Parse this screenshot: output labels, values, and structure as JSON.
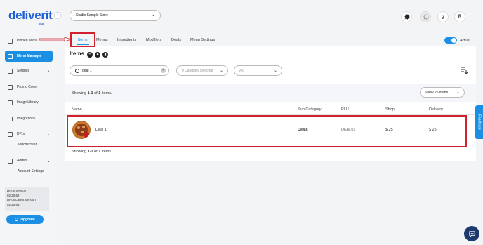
{
  "brand": {
    "name": "deliverit",
    "sub": "blue"
  },
  "sidebar": {
    "items": [
      {
        "label": "Pinned Menu",
        "icon": "pin-icon"
      },
      {
        "label": "Menu Manager",
        "icon": "menu-manager-icon"
      },
      {
        "label": "Settings",
        "icon": "settings-icon"
      },
      {
        "label": "Promo Code",
        "icon": "promo-icon"
      },
      {
        "label": "Image Library",
        "icon": "image-icon"
      },
      {
        "label": "Integrations",
        "icon": "integrations-icon"
      },
      {
        "label": "DPos",
        "icon": "dpos-icon"
      },
      {
        "label": "Admin",
        "icon": "admin-icon"
      }
    ],
    "sub_items": {
      "dpos": "Touchscreen",
      "admin": "Account Settings"
    },
    "version": {
      "dpos_label": "DPos Version",
      "dpos_value": "02.20.62",
      "latest_label": "DPos Latest Version",
      "latest_value": "02.20.63"
    },
    "upgrade_label": "Upgrade"
  },
  "header": {
    "store_select": "Studio Sample Store",
    "profile_initial": "R",
    "help": "?"
  },
  "tabs": [
    "Items",
    "Menus",
    "Ingredients",
    "Modifiers",
    "Deals",
    "Menu Settings"
  ],
  "active_label": "Active",
  "items_section": {
    "title": "Items",
    "search_value": "deal 1",
    "category_placeholder": "0 Category selected",
    "filter_value": "All",
    "showing_top": {
      "prefix": "Showing ",
      "range": "1-1",
      "mid": " of ",
      "count": "1",
      "suffix": " items."
    },
    "showing_bottom": {
      "prefix": "Showing ",
      "range": "1-1",
      "mid": " of ",
      "count": "1",
      "suffix": " items."
    },
    "per_page": "Show 25 Items",
    "columns": [
      "Name",
      "Sub Category",
      "PLU",
      "Shop",
      "Delivery"
    ],
    "rows": [
      {
        "name": "Deal 1",
        "sub_category": "Deals",
        "plu": "DEAL01",
        "shop": "$ 25",
        "delivery": "$ 25"
      }
    ]
  },
  "feedback_label": "Feedback",
  "colors": {
    "accent": "#1a8fe3",
    "annotation": "#d0212c",
    "brand": "#1f5fd6"
  }
}
